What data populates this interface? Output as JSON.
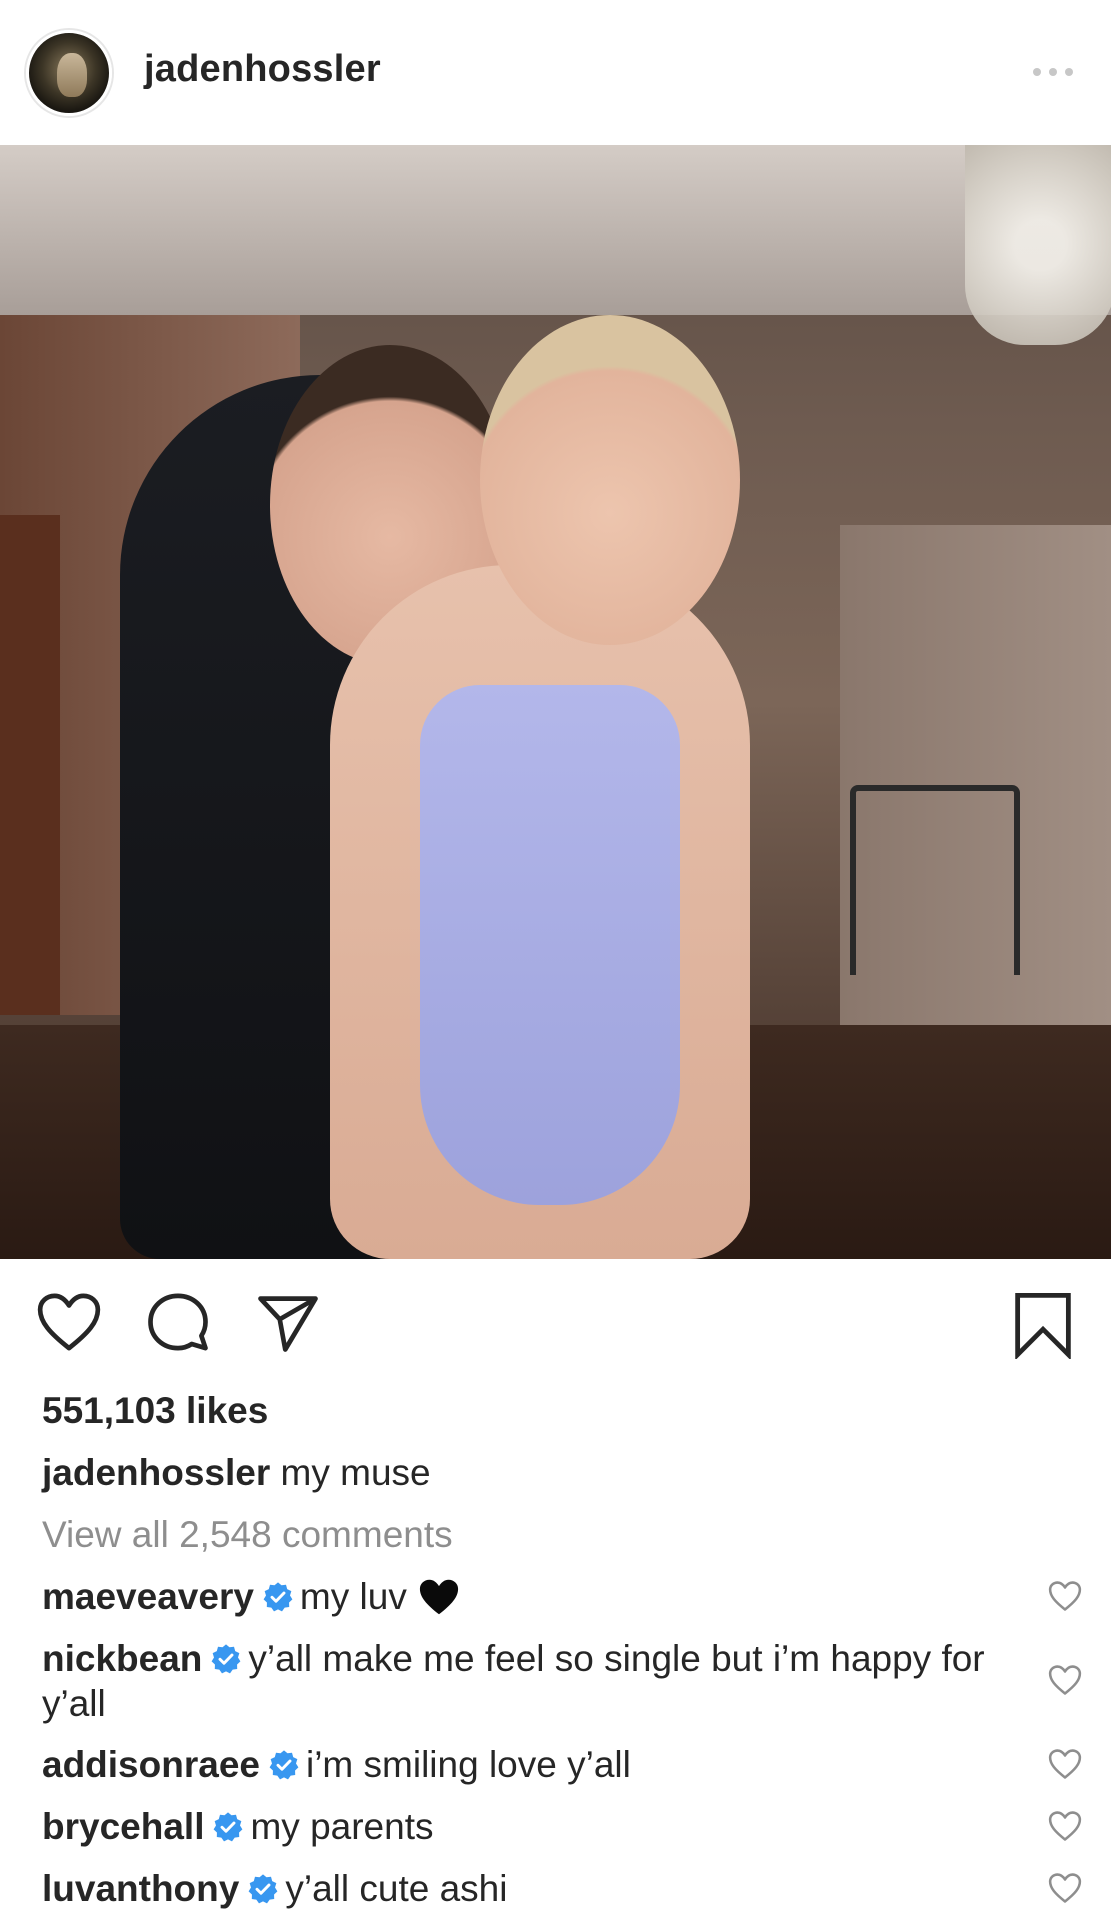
{
  "post": {
    "username": "jadenhossler",
    "likes_text": "551,103 likes",
    "caption_user": "jadenhossler",
    "caption_text": "my muse",
    "view_all_text": "View all 2,548 comments"
  },
  "comments": [
    {
      "user": "maeveavery",
      "verified": true,
      "text": "my luv",
      "emoji": "black-heart"
    },
    {
      "user": "nickbean",
      "verified": true,
      "text": "y’all make me feel so single but i’m happy for y’all"
    },
    {
      "user": "addisonraee",
      "verified": true,
      "text": "i’m smiling love y’all"
    },
    {
      "user": "brycehall",
      "verified": true,
      "text": "my parents"
    },
    {
      "user": "luvanthony",
      "verified": true,
      "text": "y’all cute ashi"
    }
  ],
  "colors": {
    "text": "#262626",
    "muted": "#8e8e8e",
    "verified_blue": "#3897f0",
    "icon_gray": "#c7c7c7"
  },
  "icons": {
    "more": "more-options-icon",
    "like": "heart-outline-icon",
    "comment": "comment-bubble-icon",
    "share": "paper-plane-icon",
    "save": "bookmark-icon",
    "verified": "verified-badge-icon",
    "comment_like": "heart-outline-small-icon"
  }
}
